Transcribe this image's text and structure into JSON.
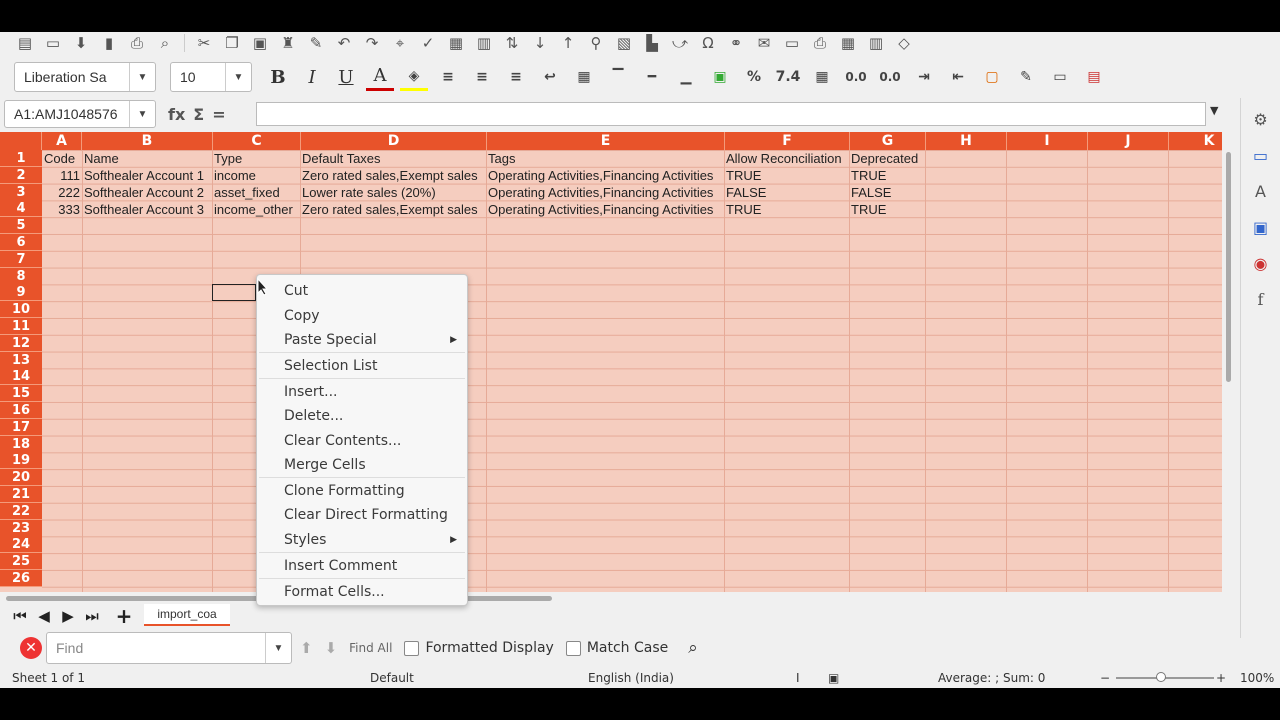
{
  "toolbar1": {
    "icons": [
      "new-icon",
      "open-icon",
      "save-icon",
      "export-pdf-icon",
      "print-icon",
      "print-preview-icon",
      "cut-icon",
      "copy-icon",
      "paste-icon",
      "clone-icon",
      "clear-icon",
      "undo-icon",
      "redo-icon",
      "find-replace-icon",
      "spelling-icon",
      "row-icon",
      "column-icon",
      "sort-icon",
      "sort-asc-icon",
      "sort-desc-icon",
      "autofilter-icon",
      "image-icon",
      "chart-icon",
      "pivot-icon",
      "special-char-icon",
      "hyperlink-icon",
      "comment-icon",
      "header-footer-icon",
      "print-range-icon",
      "freeze-icon",
      "split-icon",
      "show-draw-icon"
    ]
  },
  "toolbar2": {
    "font_name": "Liberation Sa",
    "font_size": "10",
    "bold": "B",
    "italic": "I",
    "underline": "U",
    "font_color_glyph": "A",
    "percent": "%",
    "number_format": "7.4",
    "add_decimal": "0.0",
    "del_decimal": "0.0"
  },
  "formula_bar": {
    "name_box": "A1:AMJ1048576",
    "fx": "fx",
    "sigma": "Σ",
    "equals": "=",
    "content": ""
  },
  "columns": [
    "A",
    "B",
    "C",
    "D",
    "E",
    "F",
    "G",
    "H",
    "I",
    "J",
    "K"
  ],
  "rows": [
    "1",
    "2",
    "3",
    "4",
    "5",
    "6",
    "7",
    "8",
    "9",
    "10",
    "11",
    "12",
    "13",
    "14",
    "15",
    "16",
    "17",
    "18",
    "19",
    "20",
    "21",
    "22",
    "23",
    "24",
    "25",
    "26"
  ],
  "table": {
    "row1": [
      "Code",
      "Name",
      "Type",
      "Default Taxes",
      "Tags",
      "Allow Reconciliation",
      "Deprecated"
    ],
    "row2": [
      "111",
      "Softhealer Account 1",
      "income",
      "Zero rated sales,Exempt sales",
      "Operating Activities,Financing Activities",
      "TRUE",
      "TRUE"
    ],
    "row3": [
      "222",
      "Softhealer Account 2",
      "asset_fixed",
      "Lower rate sales (20%)",
      "Operating Activities,Financing Activities",
      "FALSE",
      "FALSE"
    ],
    "row4": [
      "333",
      "Softhealer Account 3",
      "income_other",
      "Zero rated sales,Exempt sales",
      "Operating Activities,Financing Activities",
      "TRUE",
      "TRUE"
    ]
  },
  "context_menu": {
    "items": [
      "Cut",
      "Copy",
      "Paste Special",
      "Selection List",
      "Insert...",
      "Delete...",
      "Clear Contents...",
      "Merge Cells",
      "Clone Formatting",
      "Clear Direct Formatting",
      "Styles",
      "Insert Comment",
      "Format Cells..."
    ]
  },
  "sheet_tab": "import_coa",
  "find_bar": {
    "placeholder": "Find",
    "find_all": "Find All",
    "formatted_display": "Formatted Display",
    "match_case": "Match Case"
  },
  "status": {
    "sheet": "Sheet 1 of 1",
    "style": "Default",
    "language": "English (India)",
    "sum": "Average: ; Sum: 0",
    "zoom": "100%"
  },
  "colors": {
    "header": "#e8532a",
    "cell_bg": "#f5cdbf"
  }
}
